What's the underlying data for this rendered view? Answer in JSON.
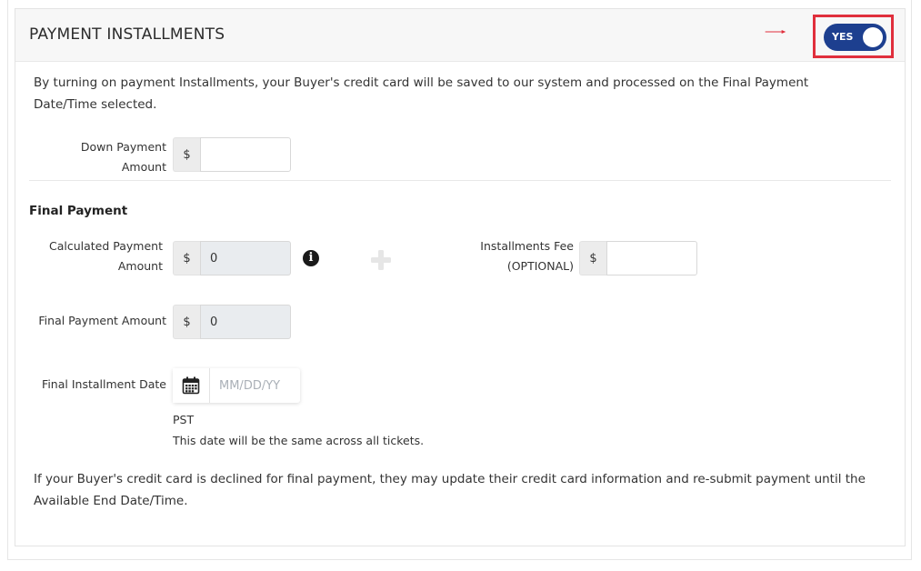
{
  "header": {
    "title": "PAYMENT INSTALLMENTS",
    "toggle_label": "YES",
    "toggle_state": "on",
    "accent_color": "#1d3f8f",
    "highlight_color": "#e02f3c"
  },
  "intro_text": "By turning on payment Installments, your Buyer's credit card will be saved to our system and processed on the Final Payment Date/Time selected.",
  "down_payment": {
    "label": "Down Payment Amount",
    "currency": "$",
    "value": ""
  },
  "final_payment": {
    "section_title": "Final Payment",
    "calculated_label_line1": "Calculated Payment",
    "calculated_label_line2": "Amount",
    "calculated_currency": "$",
    "calculated_value": "0",
    "info_icon": "info-circle-icon",
    "plus_icon": "plus-icon",
    "fee_label_line1": "Installments Fee",
    "fee_label_line2": "(OPTIONAL)",
    "fee_currency": "$",
    "fee_value": "",
    "amount_label": "Final Payment Amount",
    "amount_currency": "$",
    "amount_value": "0",
    "date_label": "Final Installment Date",
    "date_icon": "calendar-icon",
    "date_placeholder": "MM/DD/YY",
    "timezone": "PST",
    "date_note": "This date will be the same across all tickets."
  },
  "footer_note": "If your Buyer's credit card is declined for final payment, they may update their credit card information and re-submit payment until the Available End Date/Time."
}
